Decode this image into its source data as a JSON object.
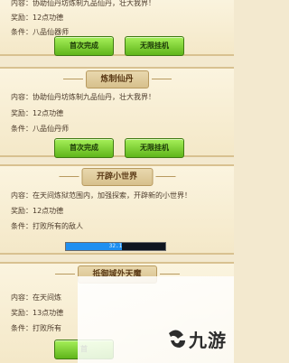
{
  "tasks": [
    {
      "banner": "",
      "content": "协助仙丹坊炼制九品仙丹，壮大我界！",
      "reward": "12点功德",
      "condition": "八品仙器师",
      "buttons": [
        "首次完成",
        "无限挂机"
      ]
    },
    {
      "banner": "炼制仙丹",
      "content": "协助仙丹坊炼制九品仙丹，壮大我界！",
      "reward": "12点功德",
      "condition": "八品仙丹师",
      "buttons": [
        "首次完成",
        "无限挂机"
      ]
    },
    {
      "banner": "开辟小世界",
      "content": "在天间炼狱范围内，加强探索，开辟新的小世界！",
      "reward": "12点功德",
      "condition": "打败所有的敌人",
      "progress": {
        "text": "32.1",
        "fraction": 0.56
      }
    },
    {
      "banner": "抵御域外天魔",
      "content": "在天间炼",
      "reward": "13点功德",
      "condition": "打败所有",
      "buttons": [
        "首"
      ]
    }
  ],
  "labels": {
    "content": "内容：",
    "reward": "奖励：",
    "condition": "条件："
  },
  "watermark": {
    "text": "九游"
  },
  "colors": {
    "button_green": "#6cc22a",
    "banner_tan": "#d7c08c",
    "progress_blue": "#1f8ff0"
  },
  "icons": {
    "logo": "nine-game-logo-icon"
  }
}
